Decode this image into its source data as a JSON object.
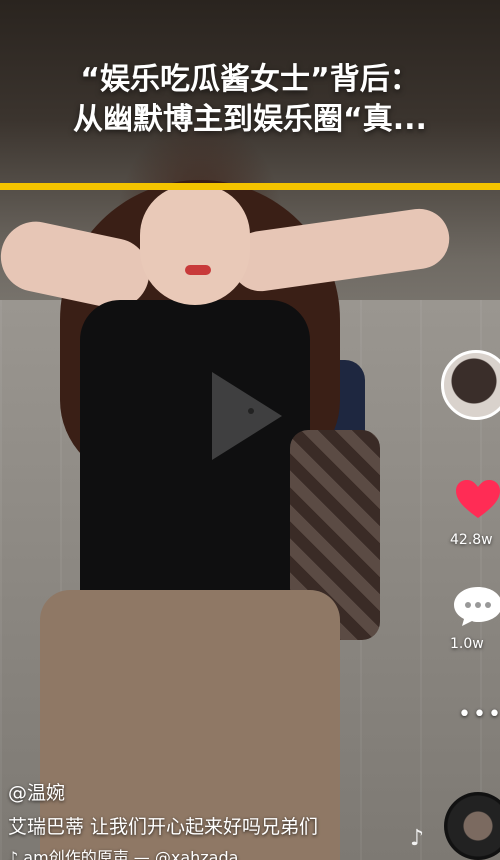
{
  "headline": {
    "line1": "“娱乐吃瓜酱女士”背后：",
    "line2": "从幽默博主到娱乐圈“真..."
  },
  "video": {
    "play_icon": "play-icon"
  },
  "sidebar": {
    "avatar_icon": "avatar-icon",
    "like_icon": "heart-icon",
    "like_count": "42.8w",
    "comment_icon": "comment-bubble-icon",
    "comment_count": "1.0w",
    "more": "•••"
  },
  "info": {
    "username": "@温婉",
    "caption": "艾瑞巴蒂 让我们开心起来好吗兄弟们",
    "music": "♪ am创作的原声 — @xahzada"
  },
  "colors": {
    "divider": "#f4c400",
    "like": "#ff2c55"
  }
}
